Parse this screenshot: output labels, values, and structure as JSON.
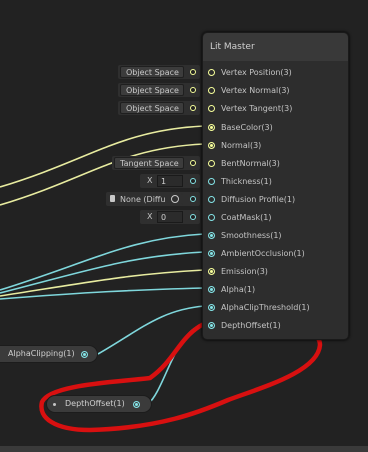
{
  "master_node": {
    "title": "Lit Master",
    "ports": [
      {
        "label": "Vertex Position(3)",
        "type": "vec3",
        "connected": false
      },
      {
        "label": "Vertex Normal(3)",
        "type": "vec3",
        "connected": false
      },
      {
        "label": "Vertex Tangent(3)",
        "type": "vec3",
        "connected": false
      },
      {
        "label": "BaseColor(3)",
        "type": "vec3",
        "connected": true
      },
      {
        "label": "Normal(3)",
        "type": "vec3",
        "connected": true
      },
      {
        "label": "BentNormal(3)",
        "type": "vec3",
        "connected": false
      },
      {
        "label": "Thickness(1)",
        "type": "vec1",
        "connected": false
      },
      {
        "label": "Diffusion Profile(1)",
        "type": "vec1",
        "connected": false
      },
      {
        "label": "CoatMask(1)",
        "type": "vec1",
        "connected": false
      },
      {
        "label": "Smoothness(1)",
        "type": "vec1",
        "connected": true
      },
      {
        "label": "AmbientOcclusion(1)",
        "type": "vec1",
        "connected": true
      },
      {
        "label": "Emission(3)",
        "type": "vec3",
        "connected": true
      },
      {
        "label": "Alpha(1)",
        "type": "vec1",
        "connected": true
      },
      {
        "label": "AlphaClipThreshold(1)",
        "type": "vec1",
        "connected": true
      },
      {
        "label": "DepthOffset(1)",
        "type": "vec1",
        "connected": true
      }
    ]
  },
  "inline_inputs": {
    "vertex_position": "Object Space",
    "vertex_normal": "Object Space",
    "vertex_tangent": "Object Space",
    "bent_normal": "Tangent Space",
    "thickness": {
      "axis": "X",
      "value": "1"
    },
    "diffusion_profile": {
      "icon": "file-icon",
      "value": "None (Diffu",
      "picker": "object-picker-icon"
    },
    "coat_mask": {
      "axis": "X",
      "value": "0"
    }
  },
  "property_nodes": {
    "alpha_clipping": "AlphaClipping(1)",
    "depth_offset": "DepthOffset(1)"
  },
  "colors": {
    "background": "#222222",
    "vec3_wire": "#f6ff9a",
    "vec1_wire": "#84e4e7",
    "annotation": "#e01010"
  }
}
